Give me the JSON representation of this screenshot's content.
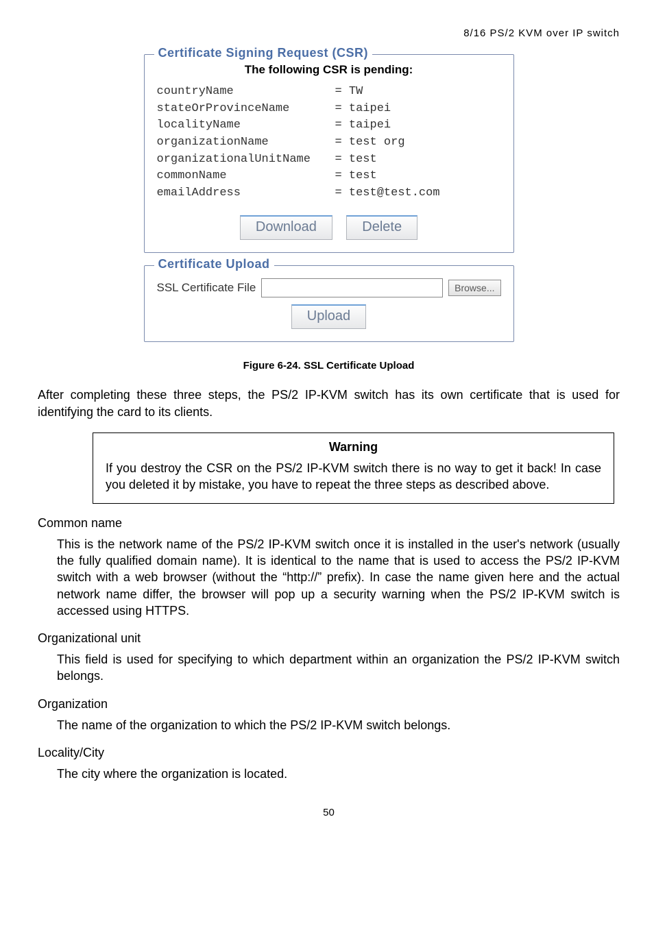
{
  "header": "8/16 PS/2 KVM over IP switch",
  "csr": {
    "legend": "Certificate Signing Request (CSR)",
    "subheading": "The following CSR is pending:",
    "rows": [
      {
        "key": "countryName",
        "val": "= TW"
      },
      {
        "key": "stateOrProvinceName",
        "val": "= taipei"
      },
      {
        "key": "localityName",
        "val": "= taipei"
      },
      {
        "key": "organizationName",
        "val": "= test org"
      },
      {
        "key": "organizationalUnitName",
        "val": "= test"
      },
      {
        "key": "commonName",
        "val": "= test"
      },
      {
        "key": "emailAddress",
        "val": "= test@test.com"
      }
    ],
    "download": "Download",
    "delete": "Delete"
  },
  "upload": {
    "legend": "Certificate Upload",
    "label": "SSL Certificate File",
    "browse": "Browse...",
    "button": "Upload"
  },
  "figure_caption": "Figure 6-24. SSL Certificate Upload",
  "after_figure_para": "After completing these three steps, the PS/2 IP-KVM switch has its own certificate that is used for identifying the card to its clients.",
  "warning": {
    "title": "Warning",
    "text": "If you destroy the CSR on the PS/2 IP-KVM switch there is no way to get it back! In case you deleted it by mistake, you have to repeat the three steps as described above."
  },
  "defs": [
    {
      "term": "Common name",
      "text": "This is the network name of the PS/2 IP-KVM switch once it is installed in the user's network (usually the fully qualified domain name). It is identical to the name that is used to access the PS/2 IP-KVM switch with a web browser (without the “http://” prefix). In case the name given here and the actual network name differ, the browser will pop up a security warning when the PS/2 IP-KVM switch is accessed using HTTPS."
    },
    {
      "term": "Organizational unit",
      "text": "This field is used for specifying to which department within an organization the PS/2 IP-KVM switch belongs."
    },
    {
      "term": "Organization",
      "text": "The name of the organization to which the PS/2 IP-KVM switch belongs."
    },
    {
      "term": "Locality/City",
      "text": "The city where the organization is located."
    }
  ],
  "page_number": "50"
}
